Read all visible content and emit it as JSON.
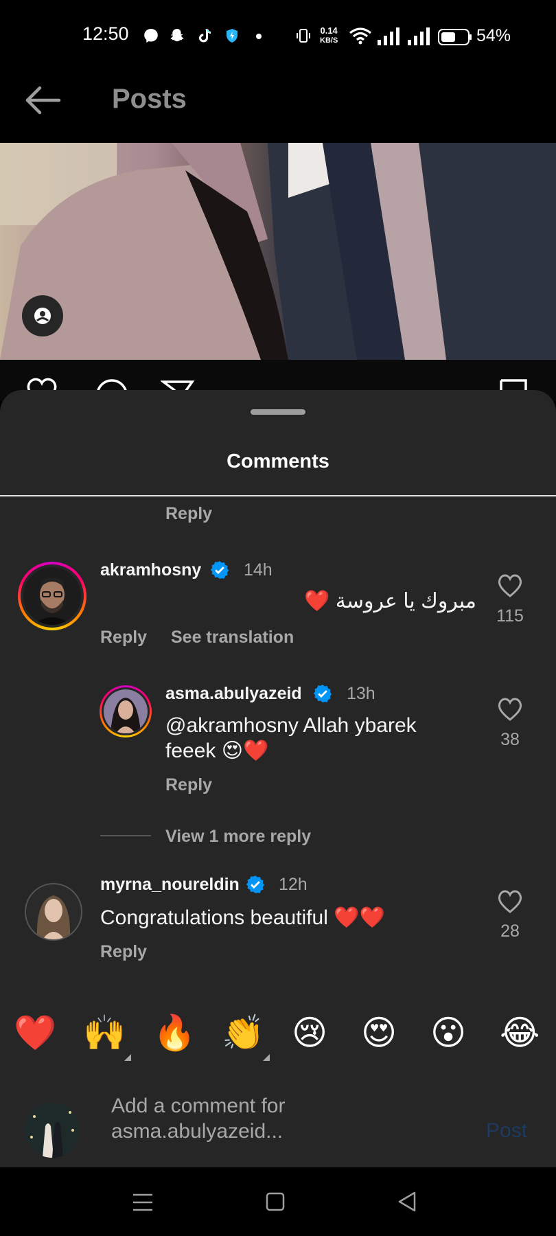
{
  "status_bar": {
    "time": "12:50",
    "net_speed_value": "0.14",
    "net_speed_unit": "KB/S",
    "battery": "54%"
  },
  "header": {
    "title": "Posts",
    "back_icon": "arrow-left-icon"
  },
  "comments_sheet": {
    "title": "Comments",
    "top_reply_label": "Reply",
    "comments": [
      {
        "username": "akramhosny",
        "verified": true,
        "time": "14h",
        "text": "مبروك يا عروسة ❤️",
        "likes": "115",
        "reply_label": "Reply",
        "translate_label": "See translation",
        "replies": [
          {
            "username": "asma.abulyazeid",
            "verified": true,
            "time": "13h",
            "text_line1": "@akramhosny Allah ybarek",
            "text_line2": "feeek 😍❤️",
            "likes": "38",
            "reply_label": "Reply"
          }
        ],
        "view_more_label": "View 1 more reply"
      },
      {
        "username": "myrna_noureldin",
        "verified": true,
        "time": "12h",
        "text": "Congratulations beautiful ❤️❤️",
        "likes": "28",
        "reply_label": "Reply"
      }
    ],
    "quick_reactions": [
      "❤️",
      "🙌",
      "🔥",
      "👏",
      "😢",
      "😍",
      "😮",
      "😂"
    ],
    "input": {
      "placeholder_line1": "Add a comment for",
      "placeholder_line2": "asma.abulyazeid...",
      "post_label": "Post"
    }
  },
  "colors": {
    "sheet_bg": "#262626",
    "verified_blue": "#0095f6",
    "muted_text": "#a8a8a8"
  }
}
